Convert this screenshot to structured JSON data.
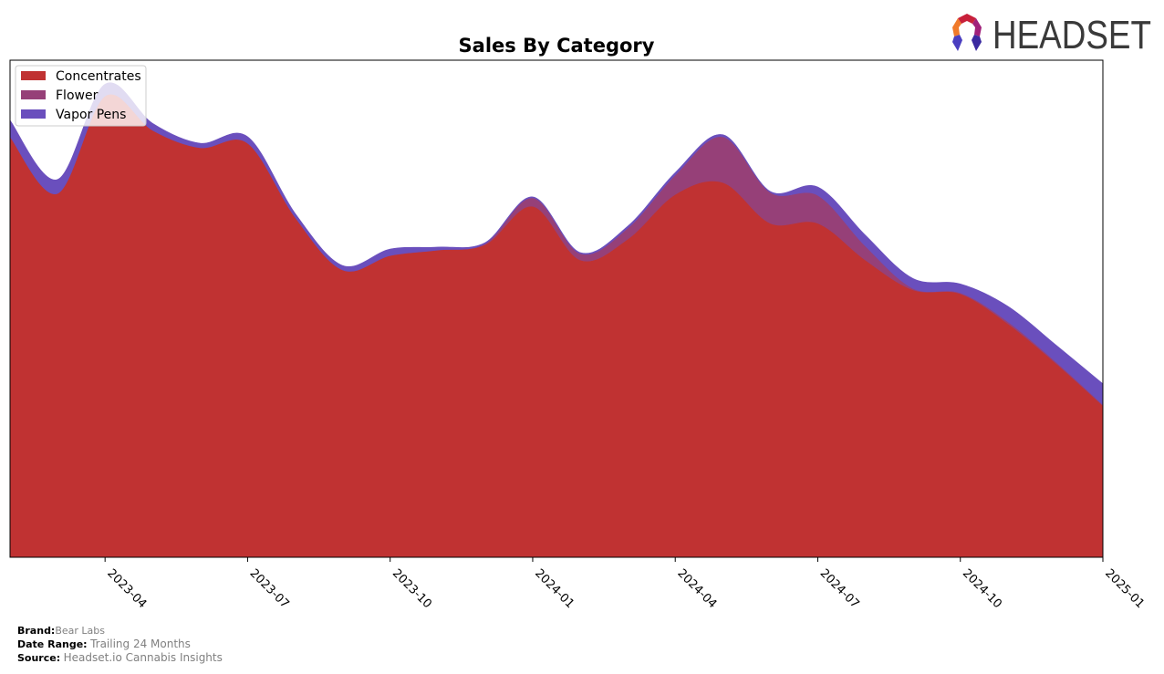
{
  "chart_data": {
    "type": "area",
    "stacked": true,
    "smoothed": true,
    "title": "Sales By Category",
    "xlabel": "",
    "ylabel": "",
    "y_ticks_visible": false,
    "ylim": [
      0,
      100
    ],
    "y_units": "relative (no axis labels shown)",
    "grid": false,
    "legend_position": "top-left",
    "x": [
      "2023-02",
      "2023-03",
      "2023-04",
      "2023-05",
      "2023-06",
      "2023-07",
      "2023-08",
      "2023-09",
      "2023-10",
      "2023-11",
      "2023-12",
      "2024-01",
      "2024-02",
      "2024-03",
      "2024-04",
      "2024-05",
      "2024-06",
      "2024-07",
      "2024-08",
      "2024-09",
      "2024-10",
      "2024-11",
      "2024-12",
      "2025-01"
    ],
    "x_tick_labels": [
      "2023-04",
      "2023-07",
      "2023-10",
      "2024-01",
      "2024-04",
      "2024-07",
      "2024-10",
      "2025-01"
    ],
    "series": [
      {
        "name": "Concentrates",
        "color": "#c03232",
        "values": [
          84.6,
          73.2,
          92.8,
          85.9,
          82.4,
          83.3,
          68.4,
          57.8,
          60.7,
          61.8,
          62.9,
          70.6,
          59.8,
          64.0,
          73.0,
          75.4,
          67.2,
          67.2,
          59.8,
          53.8,
          53.0,
          47.0,
          39.1,
          30.5
        ]
      },
      {
        "name": "Flower",
        "color": "#964078",
        "values": [
          0,
          0,
          0,
          0,
          0,
          0,
          0,
          0,
          0,
          0,
          0.2,
          1.7,
          1.3,
          2.2,
          3.9,
          9.2,
          6.2,
          5.6,
          2.8,
          0.3,
          0.2,
          0.4,
          0.3,
          0.2
        ]
      },
      {
        "name": "Vapor Pens",
        "color": "#6a4fbd",
        "values": [
          3.3,
          2.8,
          2.4,
          1.4,
          0.9,
          1.3,
          0.8,
          0.9,
          1.3,
          0.6,
          0.2,
          0.2,
          0.2,
          0.4,
          0.5,
          0.4,
          0.2,
          1.7,
          2.2,
          2.0,
          1.8,
          3.1,
          3.4,
          4.2
        ]
      }
    ]
  },
  "footer": {
    "brand_label": "Brand:",
    "brand_value": "Bear Labs",
    "date_range_label": "Date Range:",
    "date_range_value": "Trailing 24 Months",
    "source_label": "Source:",
    "source_value": "Headset.io Cannabis Insights"
  },
  "logo": {
    "text": "HEADSET"
  }
}
